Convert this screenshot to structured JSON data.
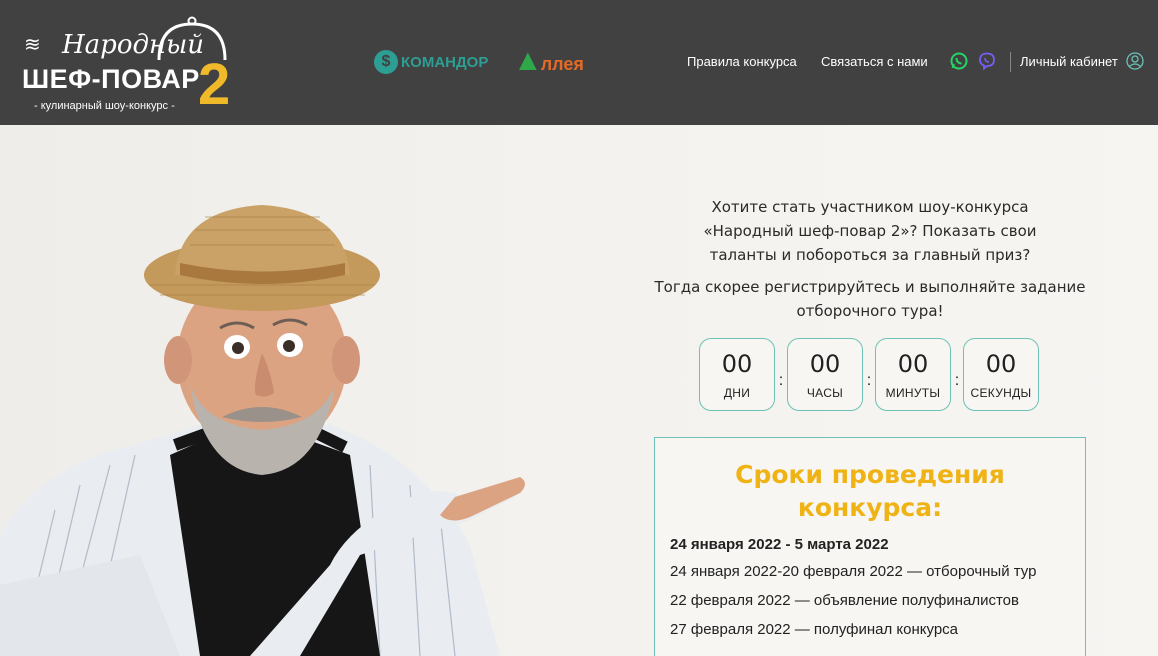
{
  "header": {
    "logo": {
      "script": "Народный",
      "title": "ШЕФ-ПОВАР",
      "number": "2",
      "tagline": "- кулинарный шоу-конкурс -"
    },
    "sponsors": [
      {
        "name": "КОМАНДОР",
        "icon": "komandor-logo-icon"
      },
      {
        "name": "ллея",
        "icon": "alleya-logo-icon"
      }
    ],
    "nav": {
      "rules": "Правила конкурса",
      "contact": "Связаться с нами",
      "cabinet": "Личный кабинет"
    }
  },
  "hero": {
    "intro_1": "Хотите стать участником шоу-конкурса «Народный шеф-повар 2»? Показать свои таланты и побороться за главный приз?",
    "intro_2": "Тогда скорее регистрируйтесь и выполняйте задание отборочного тура!",
    "countdown": {
      "days": "00",
      "days_label": "ДНИ",
      "hours": "00",
      "hours_label": "ЧАСЫ",
      "minutes": "00",
      "minutes_label": "МИНУТЫ",
      "seconds": "00",
      "seconds_label": "СЕКУНДЫ",
      "separator": ":"
    },
    "terms": {
      "title": "Сроки проведения конкурса:",
      "period": "24 января 2022 - 5 марта 2022",
      "items": [
        "24 января 2022-20 февраля 2022 — отборочный тур",
        "22 февраля 2022 — объявление полуфиналистов",
        "27 февраля 2022 — полуфинал конкурса"
      ]
    }
  },
  "colors": {
    "header_bg": "#414141",
    "accent_yellow": "#f0b316",
    "accent_teal": "#6cc2b6",
    "komandor_teal": "#2d9e93",
    "alleya_green": "#2fa84a",
    "alleya_orange": "#e36a27",
    "whatsapp_green": "#25d366",
    "viber_purple": "#7360f2"
  }
}
